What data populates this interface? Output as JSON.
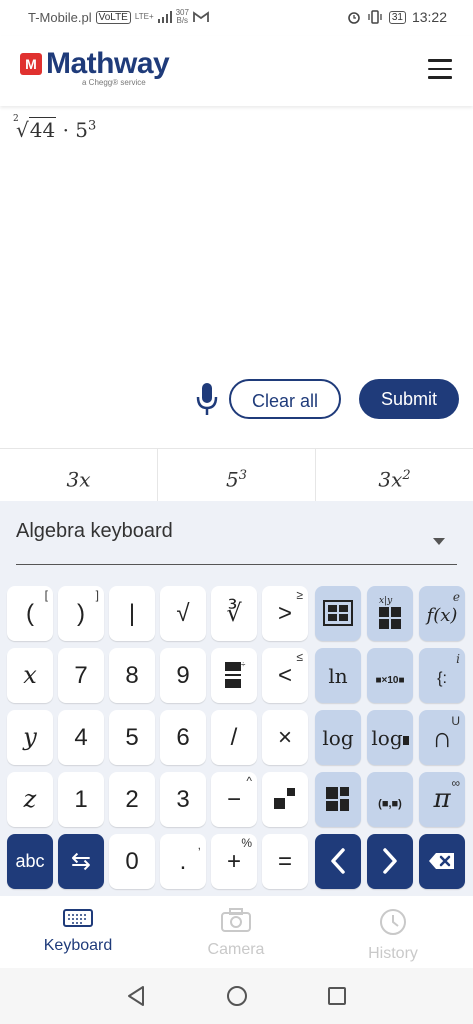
{
  "status_bar": {
    "carrier": "T-Mobile.pl",
    "volte": "VoLTE",
    "lte": "LTE+",
    "speed_top": "307",
    "speed_bottom": "B/s",
    "battery": "31",
    "time": "13:22"
  },
  "header": {
    "logo_mark": "M",
    "logo_text": "Mathway",
    "logo_sub": "a Chegg® service"
  },
  "expression": {
    "root_index": "2",
    "radicand": "44",
    "operator": "·",
    "base": "5",
    "exponent": "3"
  },
  "actions": {
    "clear_label": "Clear all",
    "submit_label": "Submit"
  },
  "suggestions": [
    {
      "base": "3x",
      "exp": ""
    },
    {
      "base": "5",
      "exp": "3"
    },
    {
      "base": "3x",
      "exp": "2"
    }
  ],
  "keyboard": {
    "selected": "Algebra keyboard",
    "keys": {
      "r1": [
        "(",
        ")",
        "|",
        "√",
        "∛",
        ">"
      ],
      "r1_corner": [
        "[",
        "]",
        "",
        "",
        "",
        "≥"
      ],
      "r2": [
        "x",
        "7",
        "8",
        "9",
        "÷",
        "<"
      ],
      "r2_corner": [
        "",
        "",
        "",
        "",
        "",
        "≤"
      ],
      "r3": [
        "y",
        "4",
        "5",
        "6",
        "/",
        "×"
      ],
      "r4": [
        "z",
        "1",
        "2",
        "3",
        "−",
        "x²"
      ],
      "r4_corner": [
        "",
        "",
        "",
        "",
        "^",
        ""
      ],
      "r5": [
        "abc",
        "⇆",
        "0",
        ".",
        "+",
        "="
      ],
      "r5_corner": [
        "",
        "",
        "",
        ",",
        "%",
        ""
      ],
      "side_r1": [
        "[■■]",
        "x|y",
        "f(x)"
      ],
      "side_r1_corner": [
        "",
        "",
        "e"
      ],
      "side_r2": [
        "ln",
        "■×10■",
        "{:"
      ],
      "side_r2_corner": [
        "",
        "",
        "i"
      ],
      "side_r3": [
        "log",
        "log",
        "∩"
      ],
      "side_r3_corner": [
        "",
        "",
        "U"
      ],
      "side_r4": [
        "▪▪",
        "(■,■)",
        "π"
      ],
      "side_r4_corner": [
        "",
        "",
        "∞"
      ],
      "side_r5": [
        "<",
        ">",
        "⌫"
      ]
    }
  },
  "bottom_nav": [
    {
      "label": "Keyboard",
      "icon": "keyboard-icon",
      "active": true
    },
    {
      "label": "Camera",
      "icon": "camera-icon",
      "active": false
    },
    {
      "label": "History",
      "icon": "history-icon",
      "active": false
    }
  ],
  "colors": {
    "brand": "#1f3b7a",
    "accent_red": "#e0312f",
    "key_blue": "#c4d3ea",
    "keyboard_bg": "#eef1f7"
  }
}
